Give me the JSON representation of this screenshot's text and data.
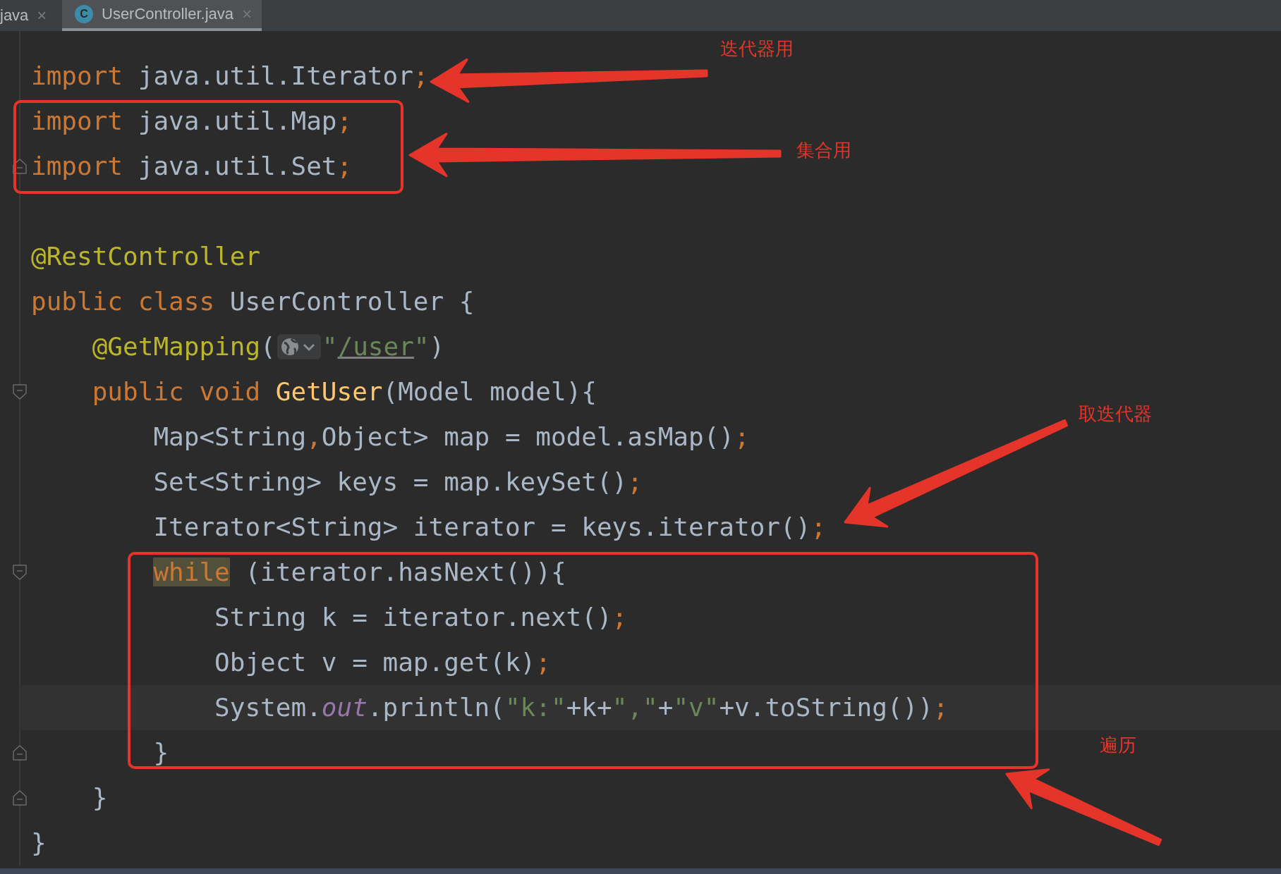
{
  "tabs": [
    {
      "label": "java",
      "selected": false,
      "close": "×"
    },
    {
      "label": "UserController.java",
      "selected": true,
      "icon_letter": "C",
      "close": "×"
    }
  ],
  "lines": [
    {
      "current": false,
      "fold_start": false,
      "fold_end": false,
      "tokens": [
        {
          "text": "import",
          "kind": "keyword"
        },
        {
          "text": " java.util.Iterator",
          "kind": "plain"
        },
        {
          "text": ";",
          "kind": "punct"
        }
      ]
    },
    {
      "current": false,
      "fold_start": false,
      "fold_end": false,
      "tokens": [
        {
          "text": "import",
          "kind": "keyword"
        },
        {
          "text": " java.util.Map",
          "kind": "plain"
        },
        {
          "text": ";",
          "kind": "punct"
        }
      ]
    },
    {
      "current": false,
      "fold_start": false,
      "fold_end": true,
      "tokens": [
        {
          "text": "import",
          "kind": "keyword"
        },
        {
          "text": " java.util.Set",
          "kind": "plain"
        },
        {
          "text": ";",
          "kind": "punct"
        }
      ]
    },
    {
      "current": false,
      "fold_start": false,
      "fold_end": false
    },
    {
      "current": false,
      "fold_start": false,
      "fold_end": false,
      "tokens": [
        {
          "text": "@RestController",
          "kind": "annotation"
        }
      ]
    },
    {
      "current": false,
      "fold_start": false,
      "fold_end": false,
      "tokens": [
        {
          "text": "public class ",
          "kind": "keyword"
        },
        {
          "text": "UserController {",
          "kind": "plain"
        }
      ]
    },
    {
      "current": false,
      "fold_start": false,
      "fold_end": false,
      "tokens": [
        {
          "text": "    @GetMapping",
          "kind": "annotation"
        },
        {
          "text": "(",
          "kind": "plain"
        },
        {
          "kind": "hint"
        },
        {
          "text": "\"",
          "kind": "string"
        },
        {
          "text": "/user",
          "kind": "url"
        },
        {
          "text": "\"",
          "kind": "string"
        },
        {
          "text": ")",
          "kind": "plain"
        }
      ]
    },
    {
      "current": false,
      "fold_start": true,
      "fold_end": false,
      "tokens": [
        {
          "text": "    public void ",
          "kind": "keyword"
        },
        {
          "text": "GetUser",
          "kind": "method"
        },
        {
          "text": "(Model model){",
          "kind": "plain"
        }
      ]
    },
    {
      "current": false,
      "fold_start": false,
      "fold_end": false,
      "tokens": [
        {
          "text": "        Map<String",
          "kind": "plain"
        },
        {
          "text": ",",
          "kind": "punct"
        },
        {
          "text": "Object> map = model.asMap()",
          "kind": "plain"
        },
        {
          "text": ";",
          "kind": "punct"
        }
      ]
    },
    {
      "current": false,
      "fold_start": false,
      "fold_end": false,
      "tokens": [
        {
          "text": "        Set<String> keys = map.keySet()",
          "kind": "plain"
        },
        {
          "text": ";",
          "kind": "punct"
        }
      ]
    },
    {
      "current": false,
      "fold_start": false,
      "fold_end": false,
      "tokens": [
        {
          "text": "        Iterator<String> iterator = keys.iterator()",
          "kind": "plain"
        },
        {
          "text": ";",
          "kind": "punct"
        }
      ]
    },
    {
      "current": false,
      "fold_start": true,
      "fold_end": false,
      "tokens": [
        {
          "text": "        while",
          "kind": "keyword_marked"
        },
        {
          "text": " (iterator.hasNext()){",
          "kind": "plain"
        }
      ]
    },
    {
      "current": false,
      "fold_start": false,
      "fold_end": false,
      "tokens": [
        {
          "text": "            String k = iterator.next()",
          "kind": "plain"
        },
        {
          "text": ";",
          "kind": "punct"
        }
      ]
    },
    {
      "current": false,
      "fold_start": false,
      "fold_end": false,
      "tokens": [
        {
          "text": "            Object v = map.get(k)",
          "kind": "plain"
        },
        {
          "text": ";",
          "kind": "punct"
        }
      ]
    },
    {
      "current": true,
      "fold_start": false,
      "fold_end": false,
      "tokens": [
        {
          "text": "            System.",
          "kind": "plain"
        },
        {
          "text": "out",
          "kind": "static"
        },
        {
          "text": ".println(",
          "kind": "plain"
        },
        {
          "text": "\"k:\"",
          "kind": "string"
        },
        {
          "text": "+k+",
          "kind": "plain"
        },
        {
          "text": "\",\"",
          "kind": "string"
        },
        {
          "text": "+",
          "kind": "plain"
        },
        {
          "text": "\"v\"",
          "kind": "string"
        },
        {
          "text": "+v.toString())",
          "kind": "plain"
        },
        {
          "text": ";",
          "kind": "punct"
        }
      ]
    },
    {
      "current": false,
      "fold_start": false,
      "fold_end": true,
      "tokens": [
        {
          "text": "        }",
          "kind": "plain"
        }
      ]
    },
    {
      "current": false,
      "fold_start": false,
      "fold_end": true,
      "tokens": [
        {
          "text": "    }",
          "kind": "plain"
        }
      ]
    },
    {
      "current": false,
      "fold_start": false,
      "fold_end": false,
      "tokens": [
        {
          "text": "}",
          "kind": "plain"
        }
      ]
    }
  ],
  "annotations": [
    {
      "text": "迭代器用"
    },
    {
      "text": "集合用"
    },
    {
      "text": "取迭代器"
    },
    {
      "text": "遍历"
    }
  ]
}
